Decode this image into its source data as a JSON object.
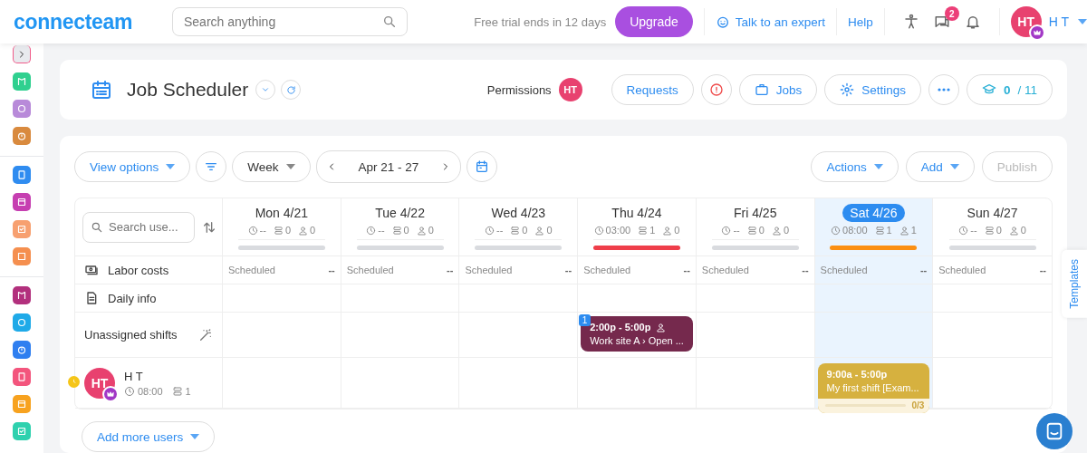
{
  "topbar": {
    "logo": "connecteam",
    "search": {
      "placeholder": "Search anything"
    },
    "trial": "Free trial ends in 12 days",
    "upgrade": "Upgrade",
    "expert": "Talk to an expert",
    "help": "Help",
    "messages_badge": "2",
    "user": {
      "initials": "HT",
      "name": "H T"
    }
  },
  "sidebar": {
    "groups": [
      {
        "items": [
          {
            "kind": "toggle",
            "color": "#e8eaee"
          },
          {
            "kind": "app",
            "color": "#2fd08f"
          },
          {
            "kind": "app",
            "color": "#b88ad9"
          },
          {
            "kind": "app",
            "color": "#d98a3e"
          }
        ]
      },
      {
        "items": [
          {
            "kind": "app",
            "color": "#2f8cf0"
          },
          {
            "kind": "app",
            "color": "#c63fb1"
          },
          {
            "kind": "app",
            "color": "#f7a070"
          },
          {
            "kind": "app",
            "color": "#f58f4f"
          }
        ]
      },
      {
        "items": [
          {
            "kind": "app",
            "color": "#b2307d"
          },
          {
            "kind": "app",
            "color": "#1faae8"
          },
          {
            "kind": "app",
            "color": "#2f7ff0"
          },
          {
            "kind": "app",
            "color": "#f3557d"
          },
          {
            "kind": "app",
            "color": "#f7a21f"
          },
          {
            "kind": "app",
            "color": "#2ed1ae"
          }
        ]
      }
    ]
  },
  "page_header": {
    "title": "Job Scheduler",
    "permissions": {
      "label": "Permissions",
      "initials": "HT"
    },
    "buttons": [
      {
        "kind": "text",
        "label": "Requests"
      },
      {
        "kind": "info"
      },
      {
        "kind": "jobs",
        "label": "Jobs"
      },
      {
        "kind": "settings",
        "label": "Settings"
      },
      {
        "kind": "more"
      },
      {
        "kind": "progress",
        "done": "0",
        "total": "/ 11"
      }
    ]
  },
  "toolbar": {
    "view_options": "View options",
    "range_unit": "Week",
    "date_range": "Apr 21 - 27",
    "actions": "Actions",
    "add": "Add",
    "publish": {
      "label": "Publish",
      "disabled": true
    }
  },
  "schedule": {
    "search": {
      "placeholder": "Search use..."
    },
    "days": [
      {
        "label": "Mon 4/21",
        "hours": "--",
        "jobs": "0",
        "users": "0",
        "color": "#d9dbdf",
        "selected": false
      },
      {
        "label": "Tue 4/22",
        "hours": "--",
        "jobs": "0",
        "users": "0",
        "color": "#d9dbdf",
        "selected": false
      },
      {
        "label": "Wed 4/23",
        "hours": "--",
        "jobs": "0",
        "users": "0",
        "color": "#d9dbdf",
        "selected": false
      },
      {
        "label": "Thu 4/24",
        "hours": "03:00",
        "jobs": "1",
        "users": "0",
        "color": "#ef3e4a",
        "selected": false
      },
      {
        "label": "Fri 4/25",
        "hours": "--",
        "jobs": "0",
        "users": "0",
        "color": "#d9dbdf",
        "selected": false
      },
      {
        "label": "Sat 4/26",
        "hours": "08:00",
        "jobs": "1",
        "users": "1",
        "color": "#fb9014",
        "selected": true
      },
      {
        "label": "Sun 4/27",
        "hours": "--",
        "jobs": "0",
        "users": "0",
        "color": "#d9dbdf",
        "selected": false
      }
    ],
    "rows": [
      {
        "kind": "labor",
        "label": "Labor costs",
        "cells": [
          {
            "status": "Scheduled",
            "cost": "--"
          },
          {
            "status": "Scheduled",
            "cost": "--"
          },
          {
            "status": "Scheduled",
            "cost": "--"
          },
          {
            "status": "Scheduled",
            "cost": "--"
          },
          {
            "status": "Scheduled",
            "cost": "--"
          },
          {
            "status": "Scheduled",
            "cost": "--"
          },
          {
            "status": "Scheduled",
            "cost": "--"
          }
        ]
      },
      {
        "kind": "daily",
        "label": "Daily info",
        "cells": [
          {},
          {},
          {},
          {},
          {},
          {},
          {}
        ]
      },
      {
        "kind": "unassigned",
        "label": "Unassigned shifts",
        "cells": [
          {},
          {},
          {},
          {
            "shift": {
              "time": "2:00p - 5:00p",
              "title": "Work site A › Open ...",
              "count": "1",
              "color": "#75294d"
            }
          },
          {},
          {},
          {}
        ]
      },
      {
        "kind": "user",
        "name": "H T",
        "initials": "HT",
        "hours": "08:00",
        "jobs": "1",
        "cells": [
          {},
          {},
          {},
          {},
          {},
          {
            "shift": {
              "time": "9:00a - 5:00p",
              "title": "My first shift [Exam...",
              "tasks": "0/3",
              "level": 0,
              "color": "#d6b13f"
            }
          },
          {}
        ]
      }
    ]
  },
  "add_users": "Add more users",
  "templates_tab": "Templates"
}
